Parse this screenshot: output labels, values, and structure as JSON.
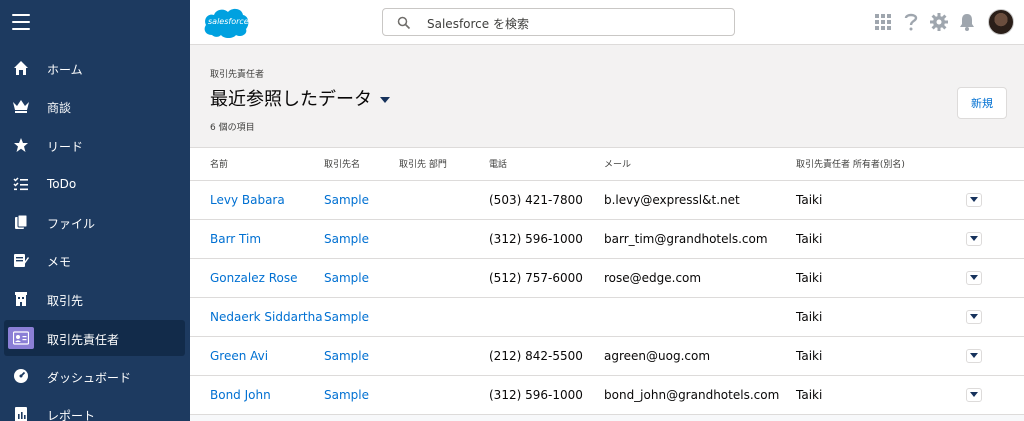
{
  "colors": {
    "sidebar": "#1d3a60",
    "accent": "#0070d2",
    "active_icon": "#8b7fd6"
  },
  "header": {
    "logo_text": "salesforce",
    "search_placeholder": "Salesforce を検索",
    "icons": [
      "app-launcher-icon",
      "help-icon",
      "setup-gear-icon",
      "notification-bell-icon",
      "user-avatar"
    ]
  },
  "sidebar": {
    "items": [
      {
        "label": "ホーム",
        "icon": "home-icon"
      },
      {
        "label": "商談",
        "icon": "crown-icon"
      },
      {
        "label": "リード",
        "icon": "lead-star-icon"
      },
      {
        "label": "ToDo",
        "icon": "todo-list-icon"
      },
      {
        "label": "ファイル",
        "icon": "files-icon"
      },
      {
        "label": "メモ",
        "icon": "note-icon"
      },
      {
        "label": "取引先",
        "icon": "building-icon"
      },
      {
        "label": "取引先責任者",
        "icon": "contact-card-icon",
        "active": true
      },
      {
        "label": "ダッシュボード",
        "icon": "dashboard-gauge-icon"
      },
      {
        "label": "レポート",
        "icon": "report-icon"
      }
    ]
  },
  "list_view": {
    "object_label": "取引先責任者",
    "view_name": "最近参照したデータ",
    "item_count": "6 個の項目",
    "new_button": "新規",
    "columns": [
      "名前",
      "取引先名",
      "取引先 部門",
      "電話",
      "メール",
      "取引先責任者 所有者(別名)"
    ],
    "rows": [
      {
        "name": "Levy Babara",
        "account": "Sample",
        "division": "",
        "phone": "(503) 421-7800",
        "email": "b.levy@expressl&t.net",
        "owner": "Taiki"
      },
      {
        "name": "Barr Tim",
        "account": "Sample",
        "division": "",
        "phone": "(312) 596-1000",
        "email": "barr_tim@grandhotels.com",
        "owner": "Taiki"
      },
      {
        "name": "Gonzalez Rose",
        "account": "Sample",
        "division": "",
        "phone": "(512) 757-6000",
        "email": "rose@edge.com",
        "owner": "Taiki"
      },
      {
        "name": "Nedaerk Siddartha",
        "account": "Sample",
        "division": "",
        "phone": "",
        "email": "",
        "owner": "Taiki"
      },
      {
        "name": "Green Avi",
        "account": "Sample",
        "division": "",
        "phone": "(212) 842-5500",
        "email": "agreen@uog.com",
        "owner": "Taiki"
      },
      {
        "name": "Bond John",
        "account": "Sample",
        "division": "",
        "phone": "(312) 596-1000",
        "email": "bond_john@grandhotels.com",
        "owner": "Taiki"
      }
    ]
  }
}
